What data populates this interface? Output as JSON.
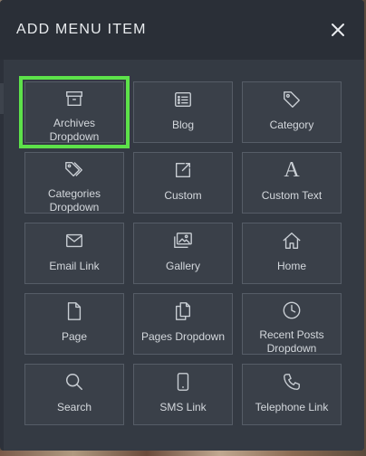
{
  "modal": {
    "title": "ADD MENU ITEM",
    "close_icon": "close-icon"
  },
  "items": [
    {
      "label": "Archives\nDropdown",
      "icon": "archive-box-icon",
      "selected": true
    },
    {
      "label": "Blog",
      "icon": "blog-list-icon"
    },
    {
      "label": "Category",
      "icon": "tag-icon"
    },
    {
      "label": "Categories\nDropdown",
      "icon": "tags-icon"
    },
    {
      "label": "Custom",
      "icon": "external-edit-icon"
    },
    {
      "label": "Custom Text",
      "icon": "letter-a-icon",
      "glyph": "A"
    },
    {
      "label": "Email Link",
      "icon": "envelope-icon"
    },
    {
      "label": "Gallery",
      "icon": "images-icon"
    },
    {
      "label": "Home",
      "icon": "house-icon"
    },
    {
      "label": "Page",
      "icon": "file-icon"
    },
    {
      "label": "Pages Dropdown",
      "icon": "copy-files-icon"
    },
    {
      "label": "Recent Posts\nDropdown",
      "icon": "clock-icon"
    },
    {
      "label": "Search",
      "icon": "search-icon"
    },
    {
      "label": "SMS Link",
      "icon": "mobile-phone-icon"
    },
    {
      "label": "Telephone Link",
      "icon": "telephone-icon"
    }
  ],
  "colors": {
    "modal_bg": "#2c313a",
    "tile_bg": "#3a4049",
    "tile_border": "#565d67",
    "selected_outline": "#5de24a",
    "text": "#d4d8dd"
  }
}
